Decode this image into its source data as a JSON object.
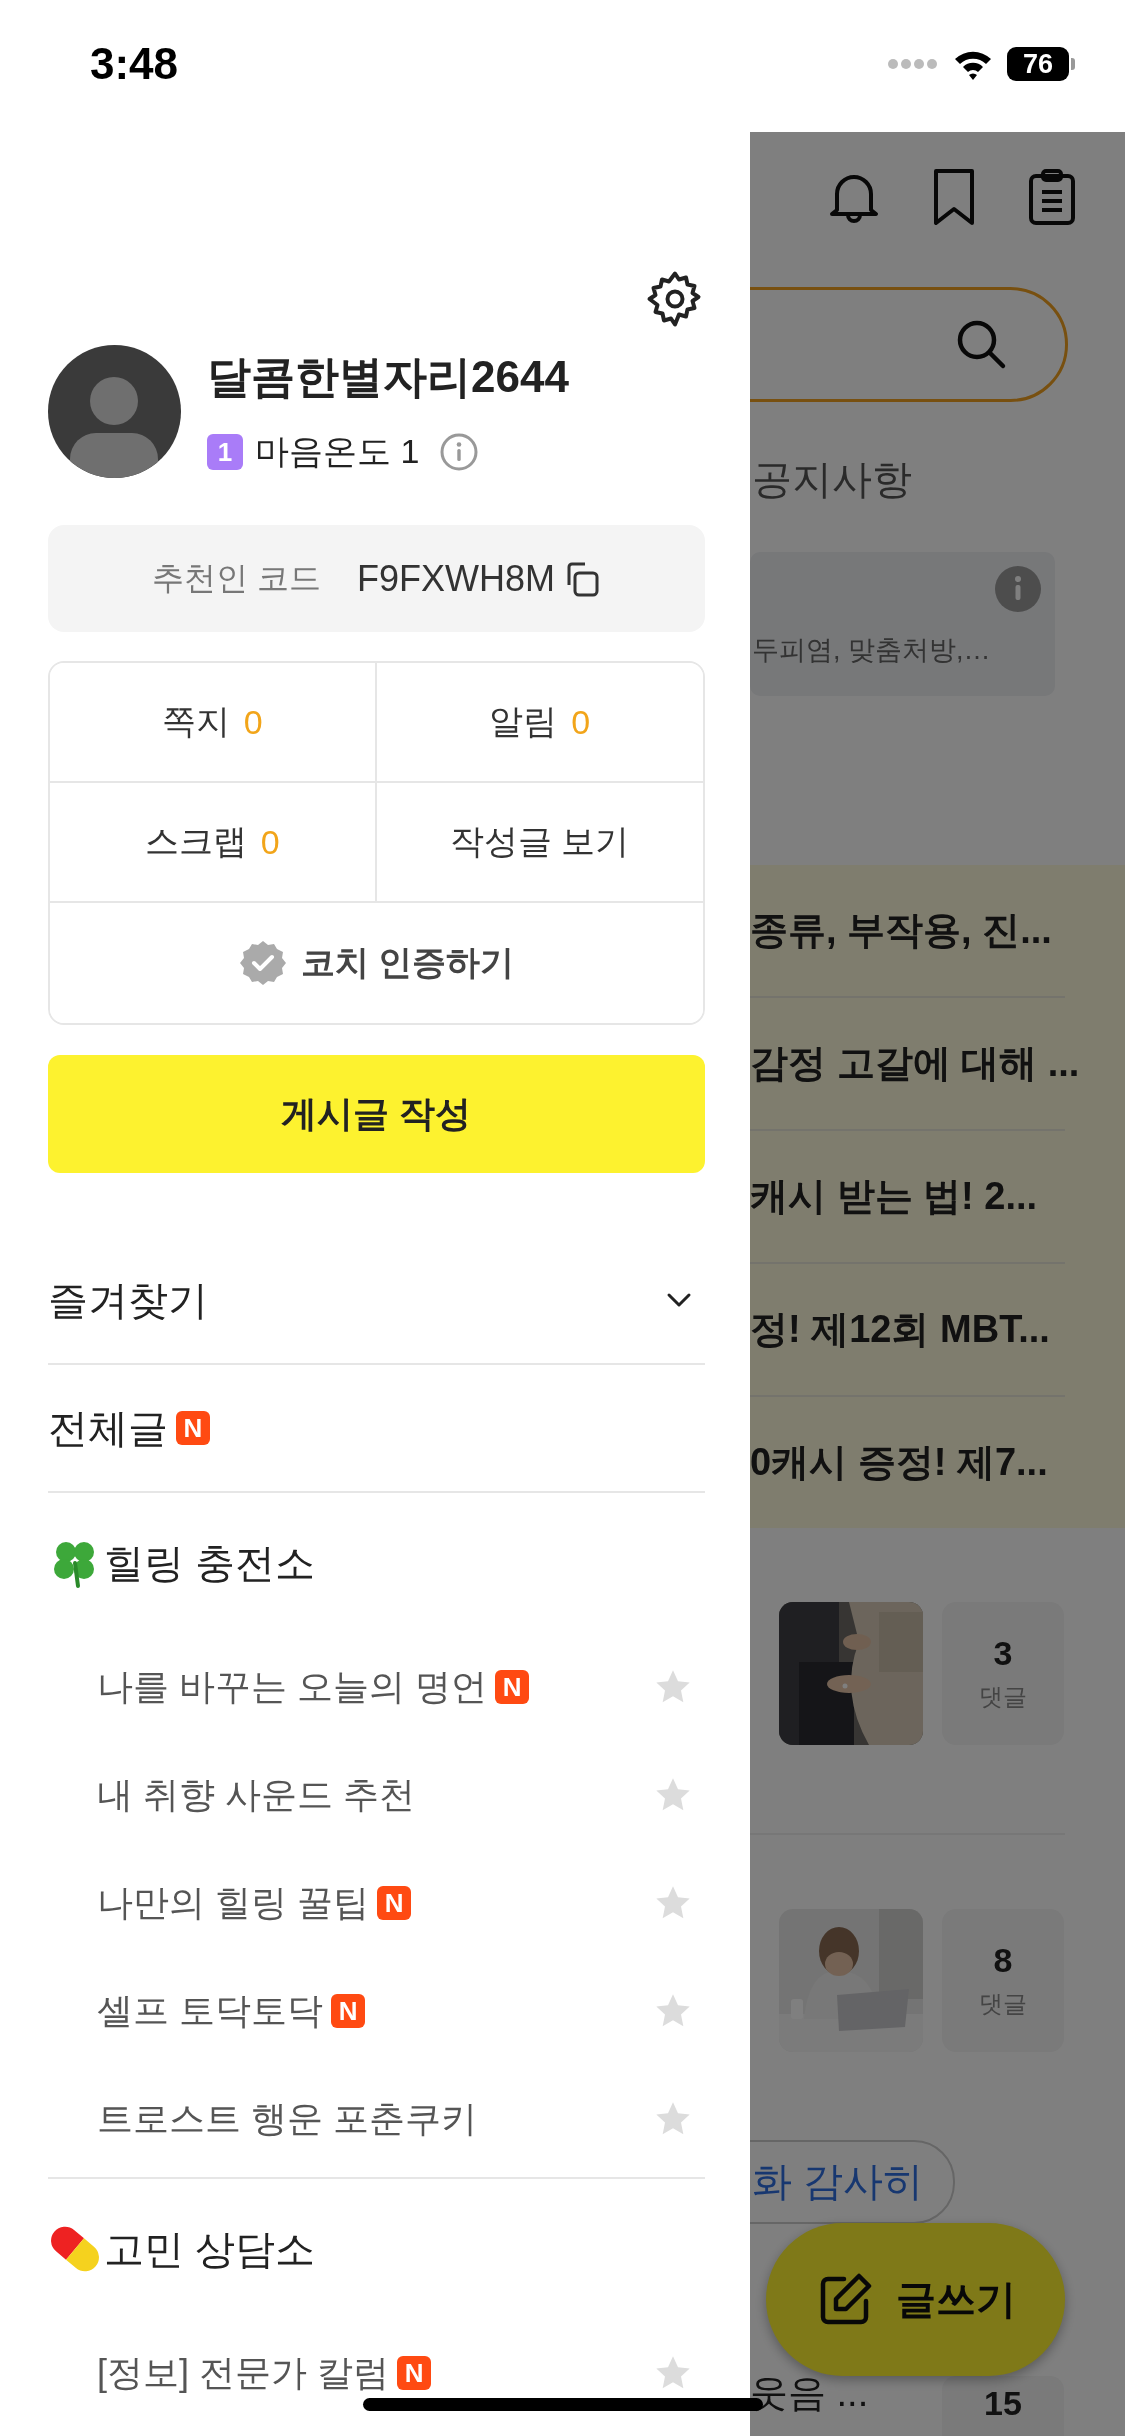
{
  "status_bar": {
    "time": "3:48",
    "battery": "76"
  },
  "drawer": {
    "profile": {
      "name": "달콤한별자리2644",
      "level_badge": "1",
      "level_label": "마음온도 1"
    },
    "referral": {
      "label": "추천인 코드",
      "code": "F9FXWH8M"
    },
    "stats": [
      {
        "label": "쪽지",
        "count": "0"
      },
      {
        "label": "알림",
        "count": "0"
      },
      {
        "label": "스크랩",
        "count": "0"
      },
      {
        "label": "작성글 보기"
      }
    ],
    "coach_button": "코치 인증하기",
    "write_button": "게시글 작성",
    "menu": [
      {
        "kind": "collapsible",
        "label": "즐겨찾기",
        "expanded": false
      },
      {
        "kind": "link",
        "label": "전체글",
        "badge": "N"
      }
    ],
    "sections": [
      {
        "label": "힐링 충전소",
        "boards": [
          {
            "label": "나를 바꾸는 오늘의 명언",
            "badge": "N",
            "favorite": false
          },
          {
            "label": "내 취향 사운드 추천",
            "favorite": false
          },
          {
            "label": "나만의 힐링 꿀팁",
            "badge": "N",
            "favorite": false
          },
          {
            "label": "셀프 토닥토닥",
            "badge": "N",
            "favorite": false
          },
          {
            "label": "트로스트 행운 포춘쿠키",
            "favorite": false
          }
        ]
      },
      {
        "label": "고민 상담소",
        "boards": [
          {
            "label": "[정보] 전문가 칼럼",
            "badge": "N",
            "favorite": false
          }
        ]
      }
    ]
  },
  "background_page": {
    "notice_tab": "공지사항",
    "info_text": "두피염, 맞춤처방,…",
    "highlight_posts": [
      "종류, 부작용, 진...",
      "감정 고갈에 대해 ...",
      "캐시 받는 법! 2...",
      "정! 제12회 MBT...",
      "0캐시 증정! 제7..."
    ],
    "posts": [
      {
        "kind": "picture",
        "comments": "3",
        "comments_label": "댓글"
      },
      {
        "kind": "picture",
        "comments": "8",
        "comments_label": "댓글"
      }
    ],
    "chip": "화 감사히",
    "last_post": {
      "title": "웃음 ...",
      "comments": "15"
    }
  },
  "fab": {
    "label": "글쓰기"
  }
}
